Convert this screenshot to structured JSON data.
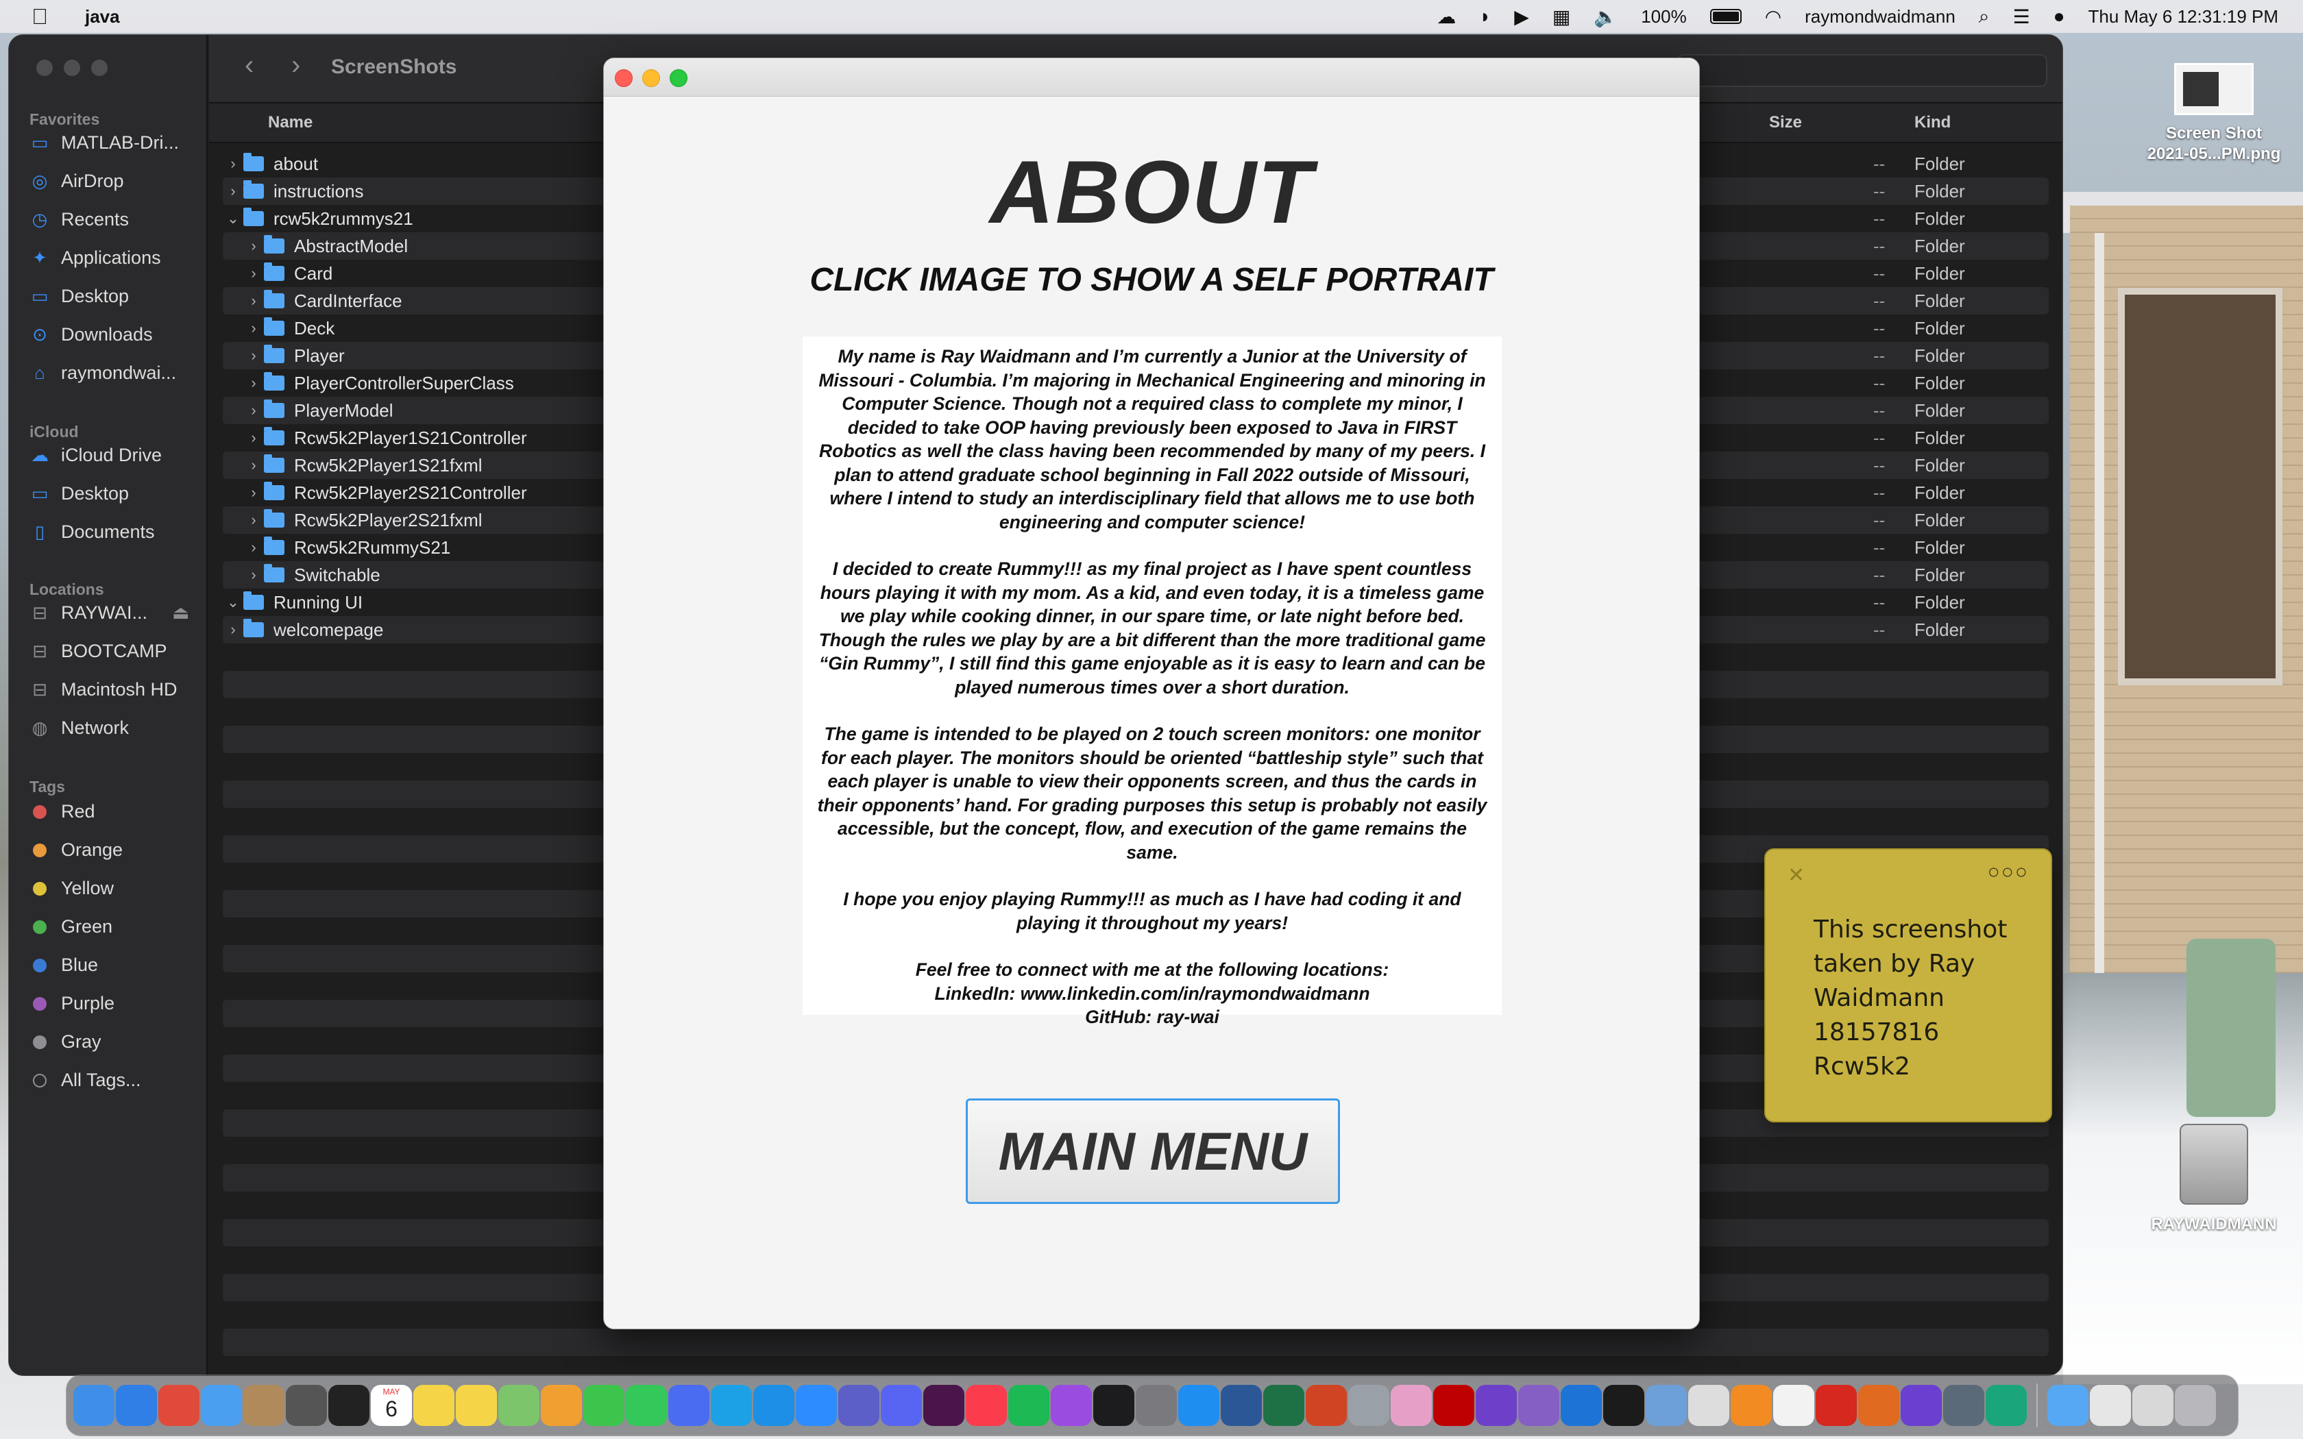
{
  "menubar": {
    "app_name": "java",
    "battery": "100%",
    "user": "raymondwaidmann",
    "datetime": "Thu May 6  12:31:19 PM"
  },
  "finder": {
    "title": "ScreenShots",
    "columns": {
      "name": "Name",
      "size": "Size",
      "kind": "Kind"
    },
    "sidebar": {
      "favorites_label": "Favorites",
      "favorites": [
        "MATLAB-Dri...",
        "AirDrop",
        "Recents",
        "Applications",
        "Desktop",
        "Downloads",
        "raymondwai..."
      ],
      "icloud_label": "iCloud",
      "icloud": [
        "iCloud Drive",
        "Desktop",
        "Documents"
      ],
      "locations_label": "Locations",
      "locations": [
        "RAYWAI...",
        "BOOTCAMP",
        "Macintosh HD",
        "Network"
      ],
      "tags_label": "Tags",
      "tags": [
        {
          "label": "Red",
          "color": "#d9534f"
        },
        {
          "label": "Orange",
          "color": "#e89a3c"
        },
        {
          "label": "Yellow",
          "color": "#e0c23a"
        },
        {
          "label": "Green",
          "color": "#4caf50"
        },
        {
          "label": "Blue",
          "color": "#3a7bd5"
        },
        {
          "label": "Purple",
          "color": "#9b59b6"
        },
        {
          "label": "Gray",
          "color": "#8e8e93"
        },
        {
          "label": "All Tags...",
          "color": ""
        }
      ]
    },
    "rows": [
      {
        "name": "about",
        "size": "--",
        "kind": "Folder",
        "level": 0,
        "expanded": false
      },
      {
        "name": "instructions",
        "size": "--",
        "kind": "Folder",
        "level": 0,
        "expanded": false
      },
      {
        "name": "rcw5k2rummys21",
        "size": "--",
        "kind": "Folder",
        "level": 0,
        "expanded": true
      },
      {
        "name": "AbstractModel",
        "size": "--",
        "kind": "Folder",
        "level": 1,
        "expanded": false
      },
      {
        "name": "Card",
        "size": "--",
        "kind": "Folder",
        "level": 1,
        "expanded": false
      },
      {
        "name": "CardInterface",
        "size": "--",
        "kind": "Folder",
        "level": 1,
        "expanded": false
      },
      {
        "name": "Deck",
        "size": "--",
        "kind": "Folder",
        "level": 1,
        "expanded": false
      },
      {
        "name": "Player",
        "size": "--",
        "kind": "Folder",
        "level": 1,
        "expanded": false
      },
      {
        "name": "PlayerControllerSuperClass",
        "size": "--",
        "kind": "Folder",
        "level": 1,
        "expanded": false
      },
      {
        "name": "PlayerModel",
        "size": "--",
        "kind": "Folder",
        "level": 1,
        "expanded": false
      },
      {
        "name": "Rcw5k2Player1S21Controller",
        "size": "--",
        "kind": "Folder",
        "level": 1,
        "expanded": false
      },
      {
        "name": "Rcw5k2Player1S21fxml",
        "size": "--",
        "kind": "Folder",
        "level": 1,
        "expanded": false
      },
      {
        "name": "Rcw5k2Player2S21Controller",
        "size": "--",
        "kind": "Folder",
        "level": 1,
        "expanded": false
      },
      {
        "name": "Rcw5k2Player2S21fxml",
        "size": "--",
        "kind": "Folder",
        "level": 1,
        "expanded": false
      },
      {
        "name": "Rcw5k2RummyS21",
        "size": "--",
        "kind": "Folder",
        "level": 1,
        "expanded": false
      },
      {
        "name": "Switchable",
        "size": "--",
        "kind": "Folder",
        "level": 1,
        "expanded": false
      },
      {
        "name": "Running UI",
        "size": "--",
        "kind": "Folder",
        "level": 0,
        "expanded": true
      },
      {
        "name": "welcomepage",
        "size": "--",
        "kind": "Folder",
        "level": 0,
        "expanded": false
      }
    ]
  },
  "about_window": {
    "heading": "ABOUT",
    "subheading": "CLICK IMAGE TO SHOW A SELF PORTRAIT",
    "paragraphs": [
      "My name is Ray Waidmann and I’m currently a Junior at the University of Missouri - Columbia. I’m majoring in Mechanical Engineering and minoring in Computer Science. Though not a required class to complete my minor, I decided to take OOP having previously been exposed to Java in FIRST Robotics as well the class having been recommended by many of my peers. I plan to attend graduate school beginning in Fall 2022 outside of Missouri, where I intend to study an interdisciplinary field that allows me to use both engineering and computer science!",
      "I decided to create Rummy!!! as my final project as I have spent countless hours playing it with my mom. As a kid, and even today, it is a timeless game we play while cooking dinner, in our spare time, or late night before bed. Though the rules we play by are a bit different than the more traditional game “Gin Rummy”, I still find this game enjoyable as it is easy to learn and can be played numerous times over a short duration.",
      "The game is intended to be played on 2 touch screen monitors: one monitor for each player. The monitors should be oriented “battleship style” such that each player is unable to view their opponents screen, and thus the cards in their opponents’ hand. For grading purposes this setup is probably not easily accessible, but the concept, flow, and execution of the game remains the same.",
      "I hope you enjoy playing Rummy!!! as much as I have had coding it and playing it throughout my years!"
    ],
    "contact_intro": "Feel free to connect with me at the following locations:",
    "contact_linkedin": "LinkedIn: www.linkedin.com/in/raymondwaidmann",
    "contact_github": "GitHub: ray-wai",
    "main_menu_label": "MAIN MENU"
  },
  "desktop": {
    "screenshot_label_line1": "Screen Shot",
    "screenshot_label_line2": "2021-05...PM.png",
    "drive_label": "RAYWAIDMANN"
  },
  "sticky_note": {
    "text": "  This screenshot\ntaken by Ray\nWaidmann\n18157816\nRcw5k2",
    "color": "#c8b23f"
  },
  "dock": {
    "calendar_month": "MAY",
    "calendar_day": "6",
    "apps": [
      {
        "icon": "finder-icon",
        "color": "#3f8fe8"
      },
      {
        "icon": "safari-icon",
        "color": "#2f7fe6"
      },
      {
        "icon": "chrome-icon",
        "color": "#e04a3b"
      },
      {
        "icon": "mail-icon",
        "color": "#4a9ff0"
      },
      {
        "icon": "contacts-icon",
        "color": "#b08a5a"
      },
      {
        "icon": "calculator-icon",
        "color": "#555555"
      },
      {
        "icon": "voice-memos-icon",
        "color": "#222222"
      },
      {
        "icon": "calendar-icon",
        "color": "#ffffff"
      },
      {
        "icon": "notes-icon",
        "color": "#f5d547"
      },
      {
        "icon": "stickies-icon",
        "color": "#f5d547"
      },
      {
        "icon": "maps-icon",
        "color": "#7cc56a"
      },
      {
        "icon": "photos-icon",
        "color": "#f0a030"
      },
      {
        "icon": "messages-icon",
        "color": "#3dc44d"
      },
      {
        "icon": "facetime-icon",
        "color": "#34c759"
      },
      {
        "icon": "messenger-icon",
        "color": "#4a6cf0"
      },
      {
        "icon": "skype-icon",
        "color": "#1da1e6"
      },
      {
        "icon": "skype-business-icon",
        "color": "#1d8fe6"
      },
      {
        "icon": "zoom-icon",
        "color": "#2d8cff"
      },
      {
        "icon": "teams-icon",
        "color": "#5b5fc7"
      },
      {
        "icon": "discord-icon",
        "color": "#5865f2"
      },
      {
        "icon": "slack-icon",
        "color": "#4a154b"
      },
      {
        "icon": "music-icon",
        "color": "#fa3c4c"
      },
      {
        "icon": "spotify-icon",
        "color": "#1db954"
      },
      {
        "icon": "podcasts-icon",
        "color": "#9b4ce0"
      },
      {
        "icon": "apple-tv-icon",
        "color": "#1c1c1e"
      },
      {
        "icon": "system-preferences-icon",
        "color": "#7a7a7e"
      },
      {
        "icon": "app-store-icon",
        "color": "#1f8ef1"
      },
      {
        "icon": "word-icon",
        "color": "#2b5797"
      },
      {
        "icon": "excel-icon",
        "color": "#1e7145"
      },
      {
        "icon": "powerpoint-icon",
        "color": "#d04423"
      },
      {
        "icon": "disk-utility-icon",
        "color": "#9aa0a8"
      },
      {
        "icon": "color-picker-icon",
        "color": "#e6a0c8"
      },
      {
        "icon": "filezilla-icon",
        "color": "#bf0000"
      },
      {
        "icon": "github-desktop-icon",
        "color": "#6e40c9"
      },
      {
        "icon": "visual-studio-icon",
        "color": "#865fc5"
      },
      {
        "icon": "xcode-icon",
        "color": "#1e73d6"
      },
      {
        "icon": "terminal-icon",
        "color": "#1b1b1b"
      },
      {
        "icon": "virtualbox-icon",
        "color": "#6d9fd8"
      },
      {
        "icon": "scenebuilder-icon",
        "color": "#dddddd"
      },
      {
        "icon": "sublime-icon",
        "color": "#f28b22"
      },
      {
        "icon": "textedit-icon",
        "color": "#f2f2f2"
      },
      {
        "icon": "acrobat-icon",
        "color": "#d6281e"
      },
      {
        "icon": "matlab-icon",
        "color": "#e06a1f"
      },
      {
        "icon": "imovie-icon",
        "color": "#6b3fcf"
      },
      {
        "icon": "screenshot-utility-icon",
        "color": "#5a6a78"
      },
      {
        "icon": "brain-app-icon",
        "color": "#1aa67a"
      }
    ],
    "right_items": [
      {
        "icon": "folder-icon",
        "color": "#56a8f5"
      },
      {
        "icon": "downloads-stack-icon",
        "color": "#e6e6e6"
      },
      {
        "icon": "documents-stack-icon",
        "color": "#d8d8d8"
      },
      {
        "icon": "trash-icon",
        "color": "#b8b8bc"
      }
    ]
  }
}
